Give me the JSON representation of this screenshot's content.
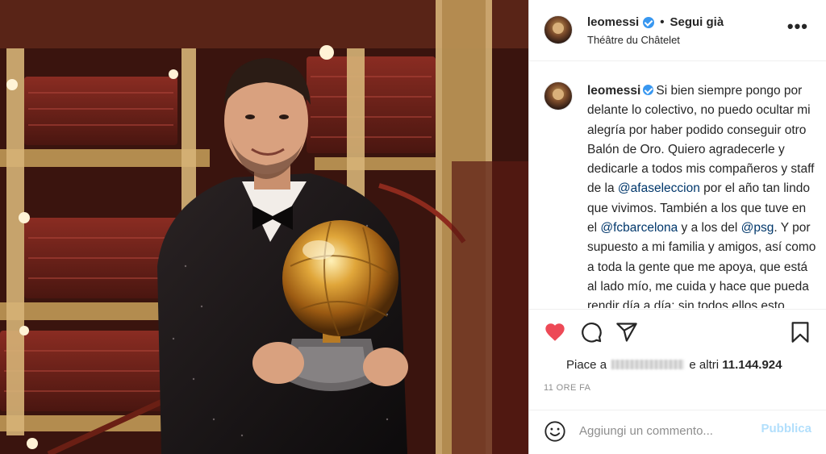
{
  "post": {
    "username": "leomessi",
    "separator": "•",
    "follow_label": "Segui già",
    "location": "Théâtre du Châtelet",
    "more_label": "•••"
  },
  "caption": {
    "username": "leomessi",
    "segments": {
      "t1": "Si bien siempre pongo por delante lo colectivo, no puedo ocultar mi alegría por haber podido conseguir otro Balón de Oro. Quiero agradecerle y dedicarle a todos mis compañeros y staff de la ",
      "m1": "@afaseleccion",
      "t2": " por el año tan lindo que vivimos. También a los que tuve en el ",
      "m2": "@fcbarcelona",
      "t3": " y a los del ",
      "m3": "@psg",
      "t4": ". Y por supuesto a mi familia y amigos, así como a toda la gente que me apoya, que está al lado mío, me cuida y hace que pueda rendir día a día: sin todos ellos esto nunca habría sido posible. Y gracias también a"
    }
  },
  "actions": {
    "icons": [
      "heart-icon",
      "comment-icon",
      "share-icon",
      "bookmark-icon"
    ],
    "like_color": "#ed4956"
  },
  "likes": {
    "prefix": "Piace a",
    "suffix": "e altri",
    "count": "11.144.924"
  },
  "timestamp": "11 ORE FA",
  "comment_box": {
    "placeholder": "Aggiungi un commento...",
    "publish_label": "Pubblica"
  },
  "colors": {
    "verified": "#3897f0",
    "mention": "#00376b",
    "publish_disabled": "#b2dffc"
  }
}
